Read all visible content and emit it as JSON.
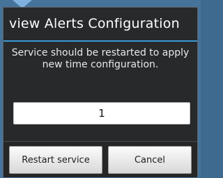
{
  "dialog": {
    "title": "view Alerts Configuration",
    "message": "Service should be restarted to apply new time configuration.",
    "input_value": "1",
    "buttons": {
      "restart_label": "Restart service",
      "cancel_label": "Cancel"
    }
  },
  "colors": {
    "background": "#46739a",
    "dialog_bg": "#27292b",
    "title_divider": "#3a9bd8",
    "button_bg": "#ececec"
  }
}
